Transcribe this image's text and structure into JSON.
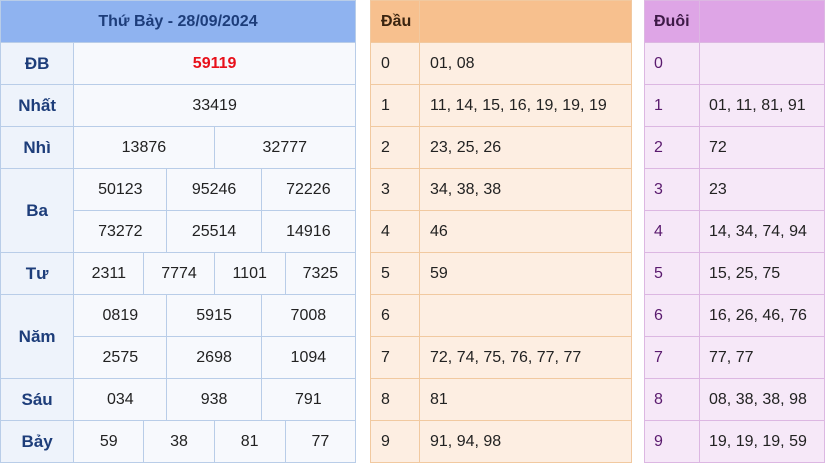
{
  "results": {
    "title": "Thứ Bảy - 28/09/2024",
    "rows": {
      "db": {
        "label": "ĐB",
        "values": [
          "59119"
        ]
      },
      "nhat": {
        "label": "Nhất",
        "values": [
          "33419"
        ]
      },
      "nhi": {
        "label": "Nhì",
        "values": [
          "13876",
          "32777"
        ]
      },
      "ba": {
        "label": "Ba",
        "values": [
          "50123",
          "95246",
          "72226",
          "73272",
          "25514",
          "14916"
        ]
      },
      "tu": {
        "label": "Tư",
        "values": [
          "2311",
          "7774",
          "1101",
          "7325"
        ]
      },
      "nam": {
        "label": "Năm",
        "values": [
          "0819",
          "5915",
          "7008",
          "2575",
          "2698",
          "1094"
        ]
      },
      "sau": {
        "label": "Sáu",
        "values": [
          "034",
          "938",
          "791"
        ]
      },
      "bay": {
        "label": "Bảy",
        "values": [
          "59",
          "38",
          "81",
          "77"
        ]
      }
    },
    "special_color": "#e8101a"
  },
  "head": {
    "title": "Đầu",
    "rows": [
      {
        "digit": "0",
        "values": "01, 08"
      },
      {
        "digit": "1",
        "values": "11, 14, 15, 16, 19, 19, 19"
      },
      {
        "digit": "2",
        "values": "23, 25, 26"
      },
      {
        "digit": "3",
        "values": "34, 38, 38"
      },
      {
        "digit": "4",
        "values": "46"
      },
      {
        "digit": "5",
        "values": "59"
      },
      {
        "digit": "6",
        "values": ""
      },
      {
        "digit": "7",
        "values": "72, 74, 75, 76, 77, 77"
      },
      {
        "digit": "8",
        "values": "81"
      },
      {
        "digit": "9",
        "values": "91, 94, 98"
      }
    ]
  },
  "tail": {
    "title": "Đuôi",
    "rows": [
      {
        "digit": "0",
        "values": ""
      },
      {
        "digit": "1",
        "values": "01, 11, 81, 91"
      },
      {
        "digit": "2",
        "values": "72"
      },
      {
        "digit": "3",
        "values": "23"
      },
      {
        "digit": "4",
        "values": "14, 34, 74, 94"
      },
      {
        "digit": "5",
        "values": "15, 25, 75"
      },
      {
        "digit": "6",
        "values": "16, 26, 46, 76"
      },
      {
        "digit": "7",
        "values": "77, 77"
      },
      {
        "digit": "8",
        "values": "08, 38, 38, 98"
      },
      {
        "digit": "9",
        "values": "19, 19, 19, 59"
      }
    ]
  }
}
